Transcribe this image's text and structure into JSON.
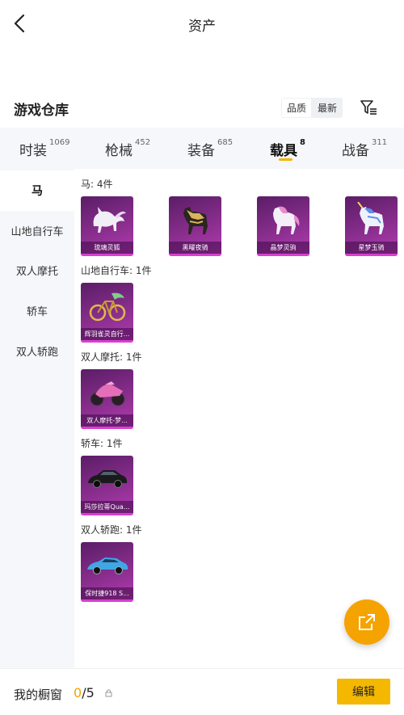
{
  "header": {
    "title": "资产"
  },
  "section": {
    "title": "游戏仓库"
  },
  "sort": {
    "options": [
      "品质",
      "最新"
    ]
  },
  "tabs": [
    {
      "label": "时装",
      "count": "1069"
    },
    {
      "label": "枪械",
      "count": "452"
    },
    {
      "label": "装备",
      "count": "685"
    },
    {
      "label": "载具",
      "count": "8"
    },
    {
      "label": "战备",
      "count": "311"
    }
  ],
  "sidebar": {
    "items": [
      {
        "label": "马"
      },
      {
        "label": "山地自行车"
      },
      {
        "label": "双人摩托"
      },
      {
        "label": "轿车"
      },
      {
        "label": "双人轿跑"
      }
    ]
  },
  "groups": [
    {
      "label": "马: 4件",
      "items": [
        {
          "name": "琉璃灵狐",
          "icon": "white-fox-icon"
        },
        {
          "name": "黑曜夜骑",
          "icon": "dark-gold-horse-icon"
        },
        {
          "name": "晶梦灵驹",
          "icon": "white-pink-horse-icon"
        },
        {
          "name": "星梦玉骑",
          "icon": "unicorn-icon"
        }
      ]
    },
    {
      "label": "山地自行车: 1件",
      "items": [
        {
          "name": "辉羽雀灵自行...",
          "icon": "golden-bike-icon"
        }
      ]
    },
    {
      "label": "双人摩托: 1件",
      "items": [
        {
          "name": "双人摩托-梦...",
          "icon": "pink-motorcycle-icon"
        }
      ]
    },
    {
      "label": "轿车: 1件",
      "items": [
        {
          "name": "玛莎拉蒂Qua...",
          "icon": "black-sedan-icon"
        }
      ]
    },
    {
      "label": "双人轿跑: 1件",
      "items": [
        {
          "name": "保时捷918 S...",
          "icon": "blue-sports-car-icon"
        }
      ]
    }
  ],
  "footer": {
    "label": "我的橱窗",
    "current": "0",
    "total": "/5",
    "edit_label": "编辑"
  },
  "colors": {
    "accent": "#f5b400",
    "card_purple": "#8a2e8e",
    "sidebar_bg": "#f5f7fa"
  }
}
